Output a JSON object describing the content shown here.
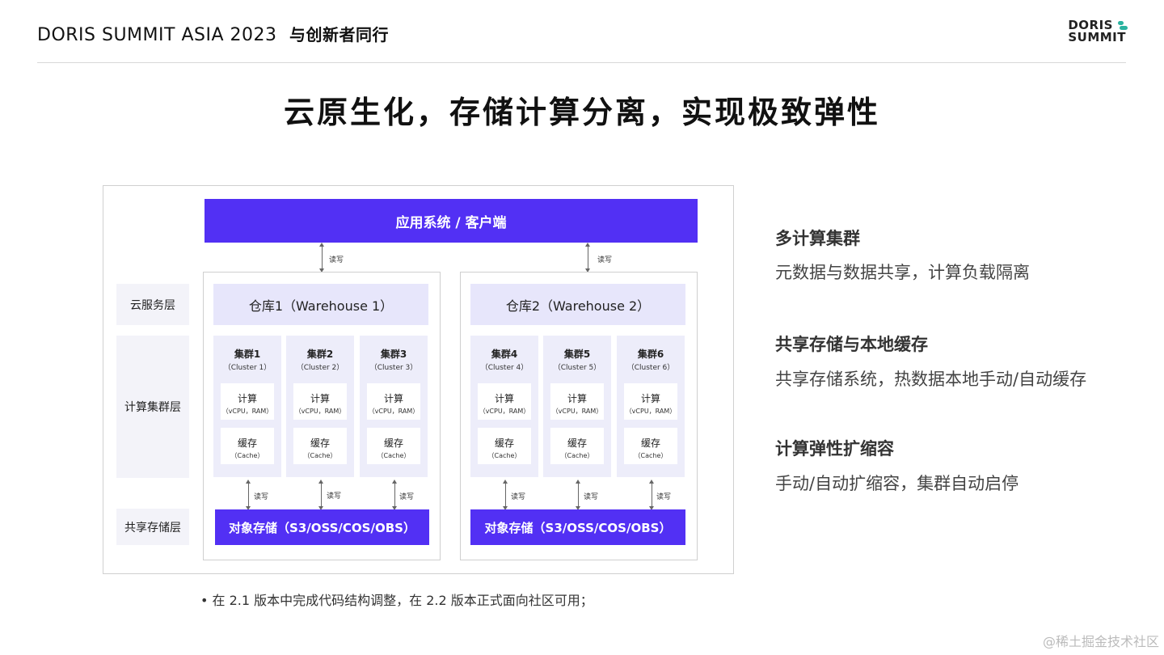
{
  "header": {
    "title": "DORIS SUMMIT ASIA 2023",
    "subtitle": "与创新者同行",
    "logo_line1": "DORIS",
    "logo_line2": "SUMMIT"
  },
  "main_title": "云原生化，存储计算分离，实现极致弹性",
  "diagram": {
    "app_bar": "应用系统 / 客户端",
    "rw_label": "读写",
    "layers": {
      "cloud_service": "云服务层",
      "compute_cluster": "计算集群层",
      "shared_storage": "共享存储层"
    },
    "warehouses": [
      {
        "name": "仓库1（Warehouse 1）",
        "storage": "对象存储（S3/OSS/COS/OBS）",
        "clusters": [
          {
            "name": "集群1",
            "sub": "（Cluster 1）",
            "compute": "计算",
            "compute_sub": "（vCPU，RAM）",
            "cache": "缓存",
            "cache_sub": "（Cache）"
          },
          {
            "name": "集群2",
            "sub": "（Cluster 2）",
            "compute": "计算",
            "compute_sub": "（vCPU，RAM）",
            "cache": "缓存",
            "cache_sub": "（Cache）"
          },
          {
            "name": "集群3",
            "sub": "（Cluster 3）",
            "compute": "计算",
            "compute_sub": "（vCPU，RAM）",
            "cache": "缓存",
            "cache_sub": "（Cache）"
          }
        ]
      },
      {
        "name": "仓库2（Warehouse 2）",
        "storage": "对象存储（S3/OSS/COS/OBS）",
        "clusters": [
          {
            "name": "集群4",
            "sub": "（Cluster 4）",
            "compute": "计算",
            "compute_sub": "（vCPU，RAM）",
            "cache": "缓存",
            "cache_sub": "（Cache）"
          },
          {
            "name": "集群5",
            "sub": "（Cluster 5）",
            "compute": "计算",
            "compute_sub": "（vCPU，RAM）",
            "cache": "缓存",
            "cache_sub": "（Cache）"
          },
          {
            "name": "集群6",
            "sub": "（Cluster 6）",
            "compute": "计算",
            "compute_sub": "（vCPU，RAM）",
            "cache": "缓存",
            "cache_sub": "（Cache）"
          }
        ]
      }
    ]
  },
  "features": [
    {
      "title": "多计算集群",
      "desc": "元数据与数据共享，计算负载隔离"
    },
    {
      "title": "共享存储与本地缓存",
      "desc": "共享存储系统，热数据本地手动/自动缓存"
    },
    {
      "title": "计算弹性扩缩容",
      "desc": "手动/自动扩缩容，集群自动启停"
    }
  ],
  "note": "• 在 2.1 版本中完成代码结构调整，在 2.2 版本正式面向社区可用；",
  "watermark": "@稀土掘金技术社区",
  "colors": {
    "accent": "#5230f4",
    "warehouse_header": "#e7e6fb",
    "cluster_bg": "#ededfa",
    "logo_mark": "#2bb3a0"
  }
}
